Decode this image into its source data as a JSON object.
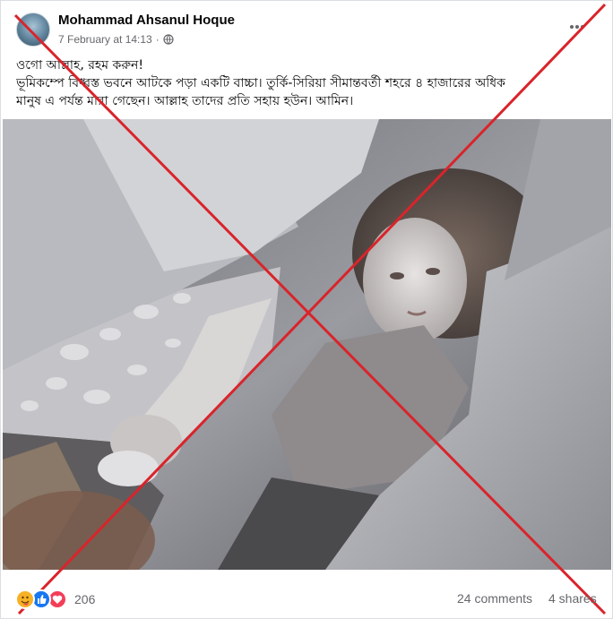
{
  "post": {
    "author": "Mohammad Ahsanul Hoque",
    "timestamp": "7 February at 14:13",
    "separator": "·",
    "privacy_icon": "globe-icon",
    "more_icon": "more-options-icon",
    "caption_lines": [
      "ওগো আল্লাহ, রহম করুন!",
      "ভূমিকম্পে বিধ্বস্ত ভবনে আটকে পড়া একটি বাচ্চা। তুর্কি-সিরিয়া সীমান্তবর্তী শহরে ৪ হাজারের অধিক",
      "মানুষ এ পর্যন্ত মারা গেছেন। আল্লাহ তাদের প্রতি সহায় হউন। আমিন।"
    ],
    "photo_description_icon": "rubble-photo"
  },
  "overlay": {
    "cross_color": "#d9242b"
  },
  "engagement": {
    "reaction_icons": [
      "care-icon",
      "like-icon",
      "love-icon"
    ],
    "reaction_count": "206",
    "comments": "24 comments",
    "shares": "4 shares"
  },
  "colors": {
    "text_primary": "#050505",
    "text_secondary": "#65676b",
    "like_blue": "#1877f2",
    "love_red": "#f33e58",
    "care_yellow": "#f7b125"
  }
}
